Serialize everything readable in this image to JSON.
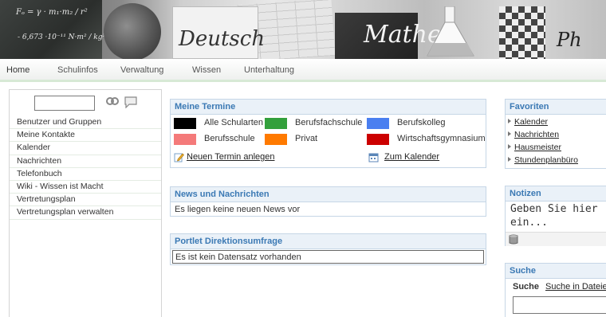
{
  "banner": {
    "formula_1": "Fₒ = γ · m₁·m₂ / r²",
    "formula_2": "- 6,673 ·10⁻¹¹ N·m² / kg²",
    "deutsch": "Deutsch",
    "mathe": "Mathe",
    "ph": "Ph"
  },
  "nav": {
    "items": [
      "Home",
      "Schulinfos",
      "Verwaltung",
      "Wissen",
      "Unterhaltung"
    ]
  },
  "sidebar": {
    "search_value": "",
    "search_icon": "search-icon",
    "chat_icon": "chat-icon",
    "items": [
      "Benutzer und Gruppen",
      "Meine Kontakte",
      "Kalender",
      "Nachrichten",
      "Telefonbuch",
      "Wiki - Wissen ist Macht",
      "Vertretungsplan",
      "Vertretungsplan verwalten"
    ]
  },
  "termine": {
    "title": "Meine Termine",
    "legend": [
      {
        "label": "Alle Schularten",
        "color": "#000000"
      },
      {
        "label": "Berufsfachschule",
        "color": "#33a03c"
      },
      {
        "label": "Berufskolleg",
        "color": "#4a7ff0"
      },
      {
        "label": "Berufsschule",
        "color": "#f47a7a"
      },
      {
        "label": "Privat",
        "color": "#ff7a00"
      },
      {
        "label": "Wirtschaftsgymnasium",
        "color": "#cc0000"
      }
    ],
    "new_link": "Neuen Termin anlegen",
    "new_icon": "pencil-edit-icon",
    "calendar_link": "Zum Kalender",
    "calendar_icon": "calendar-icon"
  },
  "news": {
    "title": "News und Nachrichten",
    "message": "Es liegen keine neuen News vor"
  },
  "umfrage": {
    "title": "Portlet Direktionsumfrage",
    "message": "Es ist kein Datensatz vorhanden"
  },
  "favoriten": {
    "title": "Favoriten",
    "items": [
      "Kalender",
      "Nachrichten",
      "Hausmeister",
      "Stundenplanbüro"
    ]
  },
  "notizen": {
    "title": "Notizen",
    "placeholder_line_1": "Geben Sie hier",
    "placeholder_line_2": "ein...",
    "save_icon": "save-disk-icon"
  },
  "suche": {
    "title": "Suche",
    "tab_active": "Suche",
    "tab_other": "Suche in Dateien",
    "input_value": ""
  },
  "colors": {
    "portlet_title": "#3b79b4",
    "portlet_head_bg": "#eaf1f8",
    "nav_border": "#d7e9d5"
  }
}
